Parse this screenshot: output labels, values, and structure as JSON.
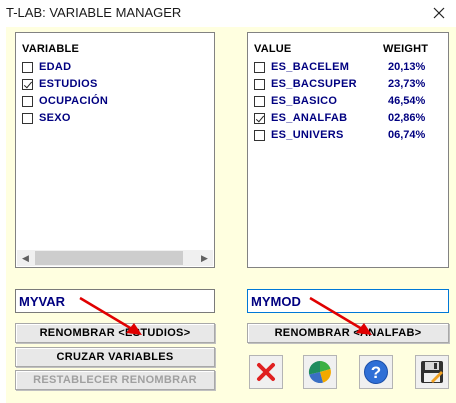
{
  "window": {
    "title": "T-LAB: VARIABLE MANAGER"
  },
  "variables_panel": {
    "header": "VARIABLE",
    "items": [
      {
        "label": "EDAD",
        "checked": false
      },
      {
        "label": "ESTUDIOS",
        "checked": true
      },
      {
        "label": "OCUPACIÓN",
        "checked": false
      },
      {
        "label": "SEXO",
        "checked": false
      }
    ]
  },
  "values_panel": {
    "header_value": "VALUE",
    "header_weight": "WEIGHT",
    "items": [
      {
        "label": "ES_BACELEM",
        "weight": "20,13%",
        "checked": false
      },
      {
        "label": "ES_BACSUPER",
        "weight": "23,73%",
        "checked": false
      },
      {
        "label": "ES_BASICO",
        "weight": "46,54%",
        "checked": false
      },
      {
        "label": "ES_ANALFAB",
        "weight": "02,86%",
        "checked": true
      },
      {
        "label": "ES_UNIVERS",
        "weight": "06,74%",
        "checked": false
      }
    ]
  },
  "inputs": {
    "variable_name": "MYVAR",
    "value_name": "MYMOD"
  },
  "buttons": {
    "rename_variable": "RENOMBRAR <ESTUDIOS>",
    "cross_variables": "CRUZAR VARIABLES",
    "restore_rename": "RESTABLECER RENOMBRAR",
    "rename_value": "RENOMBRAR <ANALFAB>"
  },
  "icons": [
    "close-icon",
    "pie-chart-icon",
    "help-icon",
    "save-icon"
  ],
  "colors": {
    "background": "#ffffe0",
    "text": "#000080",
    "arrow": "#e00000"
  }
}
